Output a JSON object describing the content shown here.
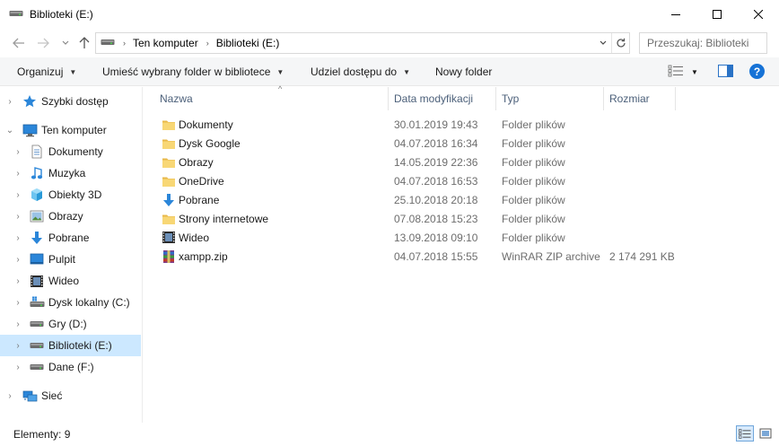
{
  "window": {
    "title": "Biblioteki (E:)",
    "icon": "drive-icon",
    "controls": {
      "minimize": "minimize-icon",
      "maximize": "maximize-icon",
      "close": "close-icon"
    }
  },
  "address": {
    "crumbs": [
      "Ten komputer",
      "Biblioteki (E:)"
    ],
    "search_placeholder": "Przeszukaj: Biblioteki (E:)"
  },
  "toolbar": {
    "organize": "Organizuj",
    "include_library": "Umieść wybrany folder w bibliotece",
    "share": "Udziel dostępu do",
    "new_folder": "Nowy folder",
    "help": "?"
  },
  "sidebar": {
    "items": [
      {
        "label": "Szybki dostęp",
        "icon": "star-icon",
        "level": 0,
        "chevron": "›",
        "selected": false
      },
      {
        "label": "Ten komputer",
        "icon": "computer-icon",
        "level": 0,
        "chevron": "⌄",
        "selected": false
      },
      {
        "label": "Dokumenty",
        "icon": "documents-icon",
        "level": 1,
        "chevron": "›",
        "selected": false
      },
      {
        "label": "Muzyka",
        "icon": "music-icon",
        "level": 1,
        "chevron": "›",
        "selected": false
      },
      {
        "label": "Obiekty 3D",
        "icon": "cube-icon",
        "level": 1,
        "chevron": "›",
        "selected": false
      },
      {
        "label": "Obrazy",
        "icon": "pictures-icon",
        "level": 1,
        "chevron": "›",
        "selected": false
      },
      {
        "label": "Pobrane",
        "icon": "download-icon",
        "level": 1,
        "chevron": "›",
        "selected": false
      },
      {
        "label": "Pulpit",
        "icon": "desktop-icon",
        "level": 1,
        "chevron": "›",
        "selected": false
      },
      {
        "label": "Wideo",
        "icon": "video-icon",
        "level": 1,
        "chevron": "›",
        "selected": false
      },
      {
        "label": "Dysk lokalny (C:)",
        "icon": "system-drive-icon",
        "level": 1,
        "chevron": "›",
        "selected": false
      },
      {
        "label": "Gry (D:)",
        "icon": "drive-icon",
        "level": 1,
        "chevron": "›",
        "selected": false
      },
      {
        "label": "Biblioteki (E:)",
        "icon": "drive-icon",
        "level": 1,
        "chevron": "›",
        "selected": true
      },
      {
        "label": "Dane (F:)",
        "icon": "drive-icon",
        "level": 1,
        "chevron": "›",
        "selected": false
      },
      {
        "label": "Sieć",
        "icon": "network-icon",
        "level": 0,
        "chevron": "›",
        "selected": false
      }
    ]
  },
  "columns": {
    "name": "Nazwa",
    "date": "Data modyfikacji",
    "type": "Typ",
    "size": "Rozmiar"
  },
  "files": [
    {
      "name": "Dokumenty",
      "date": "30.01.2019 19:43",
      "type": "Folder plików",
      "size": "",
      "icon": "folder-icon"
    },
    {
      "name": "Dysk Google",
      "date": "04.07.2018 16:34",
      "type": "Folder plików",
      "size": "",
      "icon": "folder-icon"
    },
    {
      "name": "Obrazy",
      "date": "14.05.2019 22:36",
      "type": "Folder plików",
      "size": "",
      "icon": "folder-icon"
    },
    {
      "name": "OneDrive",
      "date": "04.07.2018 16:53",
      "type": "Folder plików",
      "size": "",
      "icon": "folder-icon"
    },
    {
      "name": "Pobrane",
      "date": "25.10.2018 20:18",
      "type": "Folder plików",
      "size": "",
      "icon": "download-icon"
    },
    {
      "name": "Strony internetowe",
      "date": "07.08.2018 15:23",
      "type": "Folder plików",
      "size": "",
      "icon": "folder-icon"
    },
    {
      "name": "Wideo",
      "date": "13.09.2018 09:10",
      "type": "Folder plików",
      "size": "",
      "icon": "video-icon"
    },
    {
      "name": "xampp.zip",
      "date": "04.07.2018 15:55",
      "type": "WinRAR ZIP archive",
      "size": "2 174 291 KB",
      "icon": "winrar-archive-icon"
    }
  ],
  "status": {
    "count": "Elementy: 9"
  },
  "colors": {
    "selection": "#cce8ff",
    "folder": "#f8d775",
    "accent": "#1672d6",
    "header_text": "#4c607a"
  }
}
